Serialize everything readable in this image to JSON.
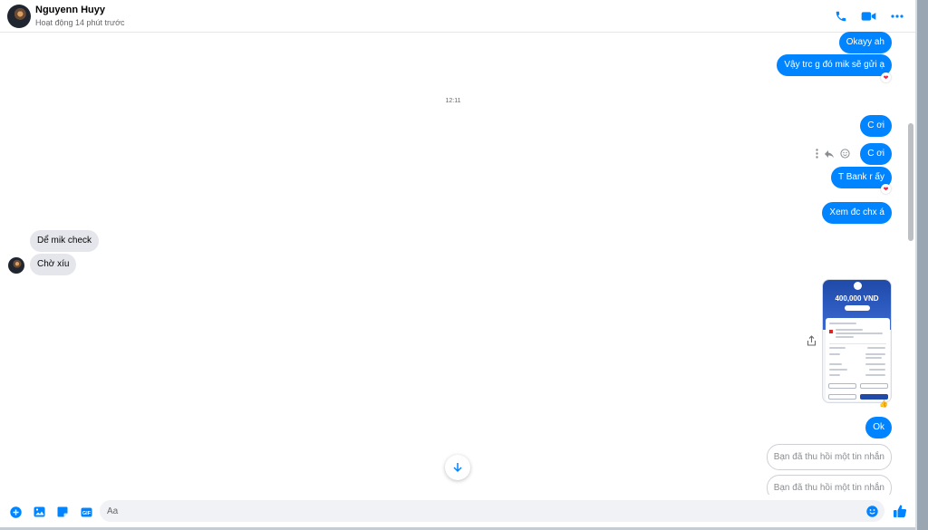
{
  "header": {
    "name": "Nguyenn Huyy",
    "status": "Hoạt động 14 phút trước"
  },
  "colors": {
    "accent": "#0084ff",
    "incoming": "#e4e6eb",
    "heart": "#f02849"
  },
  "icons": [
    "phone-icon",
    "video-call-icon",
    "more-icon",
    "plus-icon",
    "image-icon",
    "sticker-icon",
    "gif-icon",
    "emoji-icon",
    "like-icon",
    "share-icon",
    "reply-icon",
    "react-icon",
    "scroll-down-icon"
  ],
  "messages": {
    "m1": "Okayy ah",
    "m2": "Vậy trc g đó mik sẽ gửi ạ",
    "time": "12:11",
    "m3": "C ơi",
    "m4": "C ơi",
    "m5": "T Bank r ấy",
    "m6": "Xem đc chx á",
    "m7": "Dể mik check",
    "m8": "Chờ xíu",
    "m9": "Ok",
    "unsent1": "Bạn đã thu hồi một tin nhắn",
    "unsent2": "Bạn đã thu hồi một tin nhắn"
  },
  "receipt": {
    "amount": "400,000 VND"
  },
  "reactions": {
    "heart": "❤",
    "thumb": "👍"
  },
  "gif_label": "GIF",
  "composer": {
    "placeholder": "Aa"
  }
}
